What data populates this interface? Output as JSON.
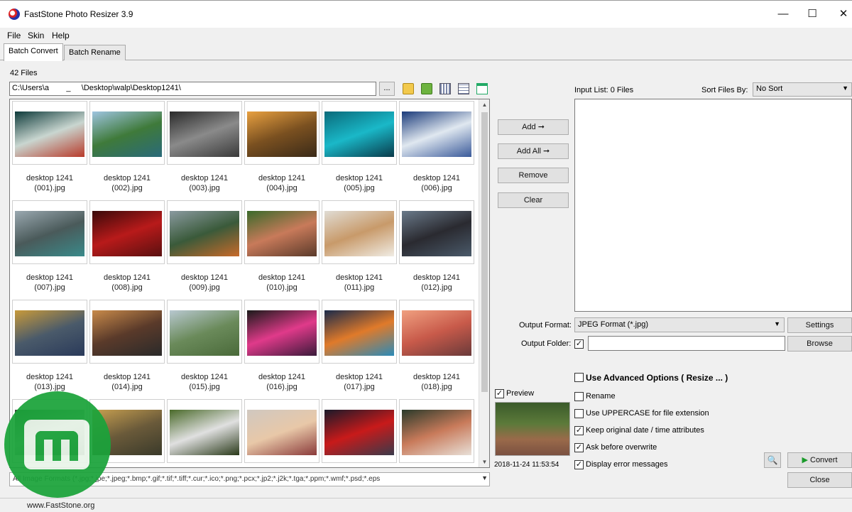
{
  "window": {
    "title": "FastStone Photo Resizer 3.9",
    "minimize": "—",
    "maximize": "☐",
    "close": "✕"
  },
  "menu": [
    "File",
    "Skin",
    "Help"
  ],
  "tabs": [
    {
      "label": "Batch Convert",
      "active": true
    },
    {
      "label": "Batch Rename",
      "active": false
    }
  ],
  "files_count": "42 Files",
  "path": "C:\\Users\\a        _     \\Desktop\\walp\\Desktop1241\\",
  "browse_dots": "...",
  "thumbnails": [
    {
      "caption1": "desktop 1241",
      "caption2": "(001).jpg",
      "colors": [
        "#0d3a3a",
        "#c9d6d0",
        "#b83a2a"
      ]
    },
    {
      "caption1": "desktop 1241",
      "caption2": "(002).jpg",
      "colors": [
        "#9ec4e0",
        "#3f7a3a",
        "#2a6a7a"
      ]
    },
    {
      "caption1": "desktop 1241",
      "caption2": "(003).jpg",
      "colors": [
        "#2a2a2a",
        "#8a8a8a",
        "#3a3a3a"
      ]
    },
    {
      "caption1": "desktop 1241",
      "caption2": "(004).jpg",
      "colors": [
        "#e8a040",
        "#7a5020",
        "#3a2a18"
      ]
    },
    {
      "caption1": "desktop 1241",
      "caption2": "(005).jpg",
      "colors": [
        "#0a6a7a",
        "#1ab8c8",
        "#0a3a4a"
      ]
    },
    {
      "caption1": "desktop 1241",
      "caption2": "(006).jpg",
      "colors": [
        "#1a3a7a",
        "#e0e8f0",
        "#3a5a9a"
      ]
    },
    {
      "caption1": "desktop 1241",
      "caption2": "(007).jpg",
      "colors": [
        "#9aa8b0",
        "#4a5a5a",
        "#3a8a8a"
      ]
    },
    {
      "caption1": "desktop 1241",
      "caption2": "(008).jpg",
      "colors": [
        "#3a0a0a",
        "#b81a1a",
        "#5a1010"
      ]
    },
    {
      "caption1": "desktop 1241",
      "caption2": "(009).jpg",
      "colors": [
        "#8a9aa0",
        "#3a5a3a",
        "#c86a2a"
      ]
    },
    {
      "caption1": "desktop 1241",
      "caption2": "(010).jpg",
      "colors": [
        "#3a6a2a",
        "#c87a5a",
        "#5a3a2a"
      ]
    },
    {
      "caption1": "desktop 1241",
      "caption2": "(011).jpg",
      "colors": [
        "#e0dcd4",
        "#c89a6a",
        "#f0ece4"
      ]
    },
    {
      "caption1": "desktop 1241",
      "caption2": "(012).jpg",
      "colors": [
        "#6a7a8a",
        "#2a2a30",
        "#4a5a6a"
      ]
    },
    {
      "caption1": "desktop 1241",
      "caption2": "(013).jpg",
      "colors": [
        "#c89a3a",
        "#4a5a6a",
        "#2a3a5a"
      ]
    },
    {
      "caption1": "desktop 1241",
      "caption2": "(014).jpg",
      "colors": [
        "#c88a4a",
        "#5a3a2a",
        "#2a2a2a"
      ]
    },
    {
      "caption1": "desktop 1241",
      "caption2": "(015).jpg",
      "colors": [
        "#b8c8d0",
        "#6a8a5a",
        "#4a6a3a"
      ]
    },
    {
      "caption1": "desktop 1241",
      "caption2": "(016).jpg",
      "colors": [
        "#1a1a1a",
        "#e03a8a",
        "#3a1a3a"
      ]
    },
    {
      "caption1": "desktop 1241",
      "caption2": "(017).jpg",
      "colors": [
        "#1a2a4a",
        "#e07a2a",
        "#2a8ab8"
      ]
    },
    {
      "caption1": "desktop 1241",
      "caption2": "(018).jpg",
      "colors": [
        "#f0a080",
        "#c85a4a",
        "#6a3a3a"
      ]
    },
    {
      "caption1": "",
      "caption2": "",
      "colors": [
        "#3a4a3a",
        "#c0c8c0",
        "#5a6a5a"
      ]
    },
    {
      "caption1": "",
      "caption2": "",
      "colors": [
        "#c8a050",
        "#6a5a3a",
        "#3a3a2a"
      ]
    },
    {
      "caption1": "",
      "caption2": "",
      "colors": [
        "#4a6a2a",
        "#e0e0e0",
        "#2a3a1a"
      ]
    },
    {
      "caption1": "",
      "caption2": "",
      "colors": [
        "#d0c8c0",
        "#e8c8a8",
        "#8a3a3a"
      ]
    },
    {
      "caption1": "",
      "caption2": "",
      "colors": [
        "#1a1a2a",
        "#c81a1a",
        "#3a3a4a"
      ]
    },
    {
      "caption1": "",
      "caption2": "",
      "colors": [
        "#2a3a2a",
        "#c87a5a",
        "#e8e0d8"
      ]
    }
  ],
  "file_filter": "All Image Formats (*.jpg;*.jpe;*.jpeg;*.bmp;*.gif;*.tif;*.tiff;*.cur;*.ico;*.png;*.pcx;*.jp2;*.j2k;*.tga;*.ppm;*.wmf;*.psd;*.eps",
  "buttons": {
    "add": "Add  ➞",
    "add_all": "Add All  ➞",
    "remove": "Remove",
    "clear": "Clear"
  },
  "input_list": {
    "label": "Input List:  0 Files",
    "sort_label": "Sort Files By:",
    "sort_value": "No Sort"
  },
  "output": {
    "format_label": "Output Format:",
    "format_value": "JPEG Format (*.jpg)",
    "settings": "Settings",
    "folder_label": "Output Folder:",
    "folder_checked": true,
    "folder_value": "",
    "browse": "Browse"
  },
  "options": [
    {
      "label": "Use Advanced Options ( Resize ... )",
      "checked": false,
      "bold": true
    },
    {
      "label": "Rename",
      "checked": false
    },
    {
      "label": "Use UPPERCASE for file extension",
      "checked": false
    },
    {
      "label": "Keep original date / time attributes",
      "checked": true
    },
    {
      "label": "Ask before overwrite",
      "checked": true
    },
    {
      "label": "Display error messages",
      "checked": true
    }
  ],
  "preview": {
    "label": "Preview",
    "checked": true,
    "date": "2018-11-24 11:53:54"
  },
  "actions": {
    "convert": "Convert",
    "close": "Close"
  },
  "status": {
    "url": "www.FastStone.org"
  }
}
